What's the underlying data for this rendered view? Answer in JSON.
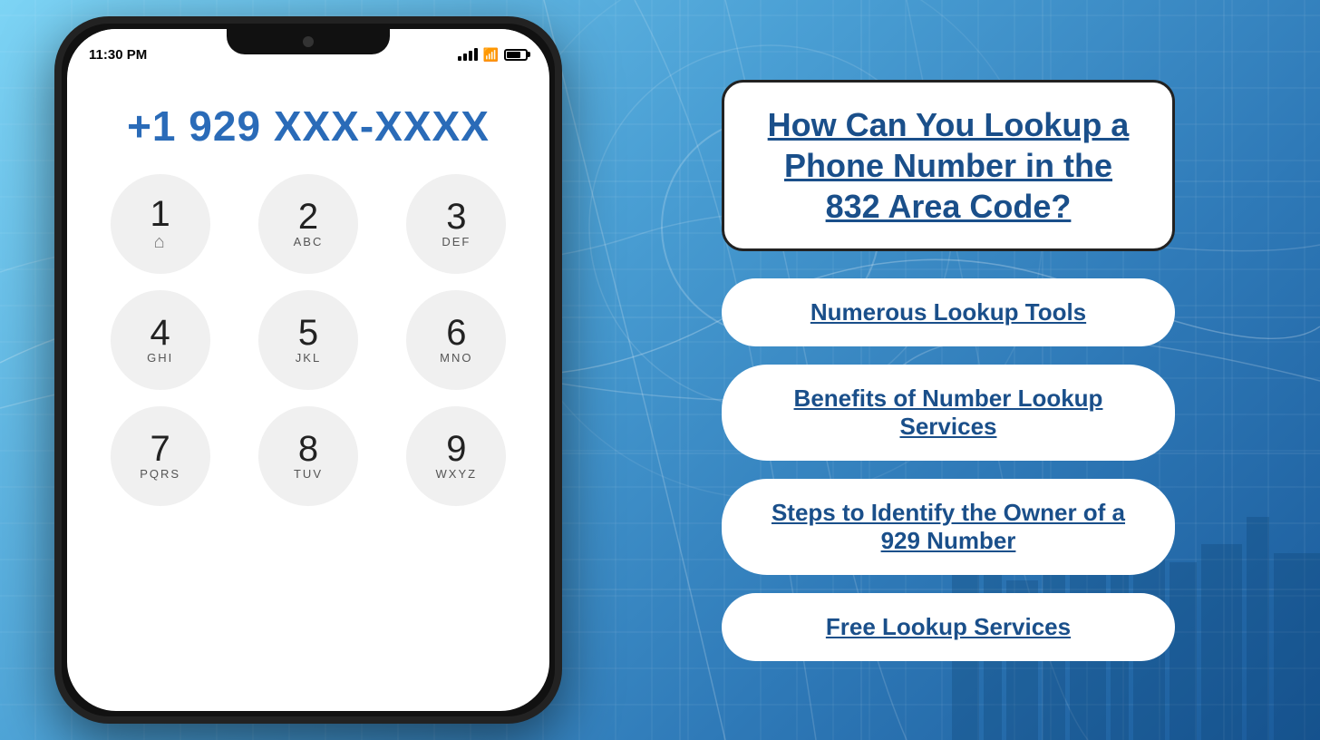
{
  "background": {
    "color_start": "#7dd4f5",
    "color_end": "#1a5a9a"
  },
  "phone": {
    "status_bar": {
      "time": "11:30 PM"
    },
    "number": "+1 929 XXX-XXXX",
    "dialpad": [
      {
        "number": "1",
        "letters": ""
      },
      {
        "number": "2",
        "letters": "ABC"
      },
      {
        "number": "3",
        "letters": "DEF"
      },
      {
        "number": "4",
        "letters": "GHI"
      },
      {
        "number": "5",
        "letters": "JKL"
      },
      {
        "number": "6",
        "letters": "MNO"
      },
      {
        "number": "7",
        "letters": "PQRS"
      },
      {
        "number": "8",
        "letters": "TUV"
      },
      {
        "number": "9",
        "letters": "WXYZ"
      }
    ]
  },
  "right_panel": {
    "title": "How Can You Lookup a Phone Number in the 832 Area Code?",
    "menu_items": [
      {
        "id": "lookup-tools",
        "label": "Numerous Lookup Tools"
      },
      {
        "id": "benefits",
        "label": "Benefits of Number Lookup Services"
      },
      {
        "id": "steps",
        "label": "Steps to Identify the Owner of a 929 Number"
      },
      {
        "id": "free-lookup",
        "label": "Free Lookup Services"
      }
    ]
  }
}
